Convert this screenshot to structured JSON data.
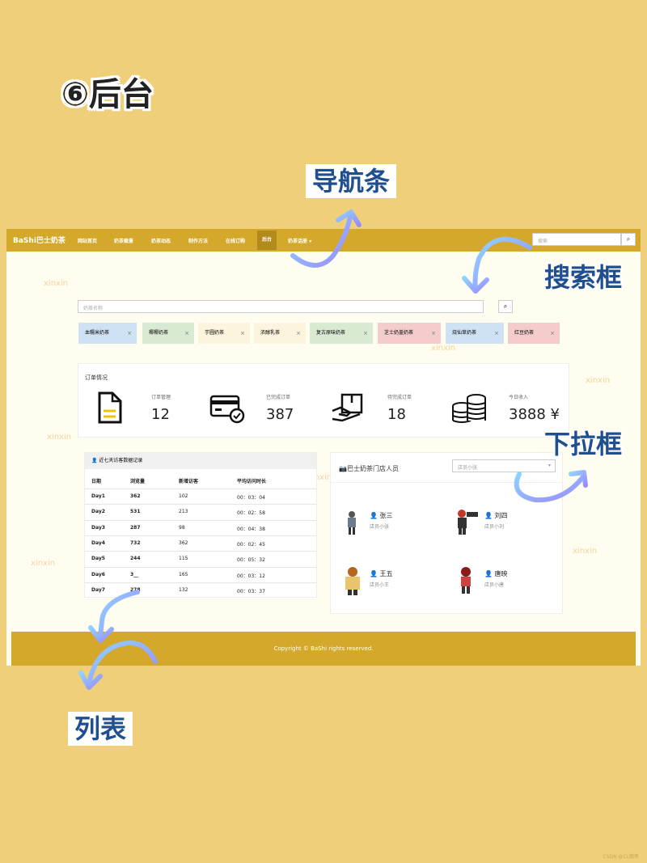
{
  "heading": "⑥后台",
  "callouts": {
    "navbar": "导航条",
    "search": "搜索框",
    "dropdown": "下拉框",
    "list": "列表"
  },
  "nav": {
    "brand": "BaShi巴士奶茶",
    "items": [
      "网站首页",
      "奶茶截景",
      "奶茶动态",
      "制作方法",
      "在线订购",
      "后台",
      "奶茶话册 ▾"
    ],
    "active_index": 5,
    "search_placeholder": "搜索"
  },
  "search": {
    "placeholder": "奶茶名称",
    "button_icon": "search-icon"
  },
  "tags": [
    {
      "label": "血糯米奶茶",
      "bg": "#cfe2f3"
    },
    {
      "label": "椰椰奶茶",
      "bg": "#d9ead3"
    },
    {
      "label": "芋圆奶茶",
      "bg": "#fcf4dc"
    },
    {
      "label": "浓醇乳茶",
      "bg": "#fcf4dc"
    },
    {
      "label": "复古原味奶茶",
      "bg": "#d9ead3"
    },
    {
      "label": "芝士奶盖奶茶",
      "bg": "#f4cccc"
    },
    {
      "label": "烧仙草奶茶",
      "bg": "#cfe2f3"
    },
    {
      "label": "红豆奶茶",
      "bg": "#f4cccc"
    }
  ],
  "watermark_text": "xinxin",
  "orders": {
    "title": "订单情况",
    "stats": [
      {
        "label": "订单管理",
        "value": "12",
        "icon": "document-icon"
      },
      {
        "label": "已完成订单",
        "value": "387",
        "icon": "credit-card-icon"
      },
      {
        "label": "待完成订单",
        "value": "18",
        "icon": "delivery-box-icon"
      },
      {
        "label": "今日收入",
        "value": "3888 ¥",
        "icon": "coins-icon"
      }
    ]
  },
  "visits": {
    "title": "近七天访客数据记录",
    "columns": [
      "日期",
      "浏览量",
      "新增访客",
      "平均访问时长"
    ],
    "rows": [
      [
        "Day1",
        "362",
        "102",
        "00：03：04"
      ],
      [
        "Day2",
        "531",
        "213",
        "00：02：58"
      ],
      [
        "Day3",
        "287",
        "98",
        "00：04：38"
      ],
      [
        "Day4",
        "732",
        "362",
        "00：02：45"
      ],
      [
        "Day5",
        "244",
        "115",
        "00：05：32"
      ],
      [
        "Day6",
        "3__",
        "165",
        "00：03：12"
      ],
      [
        "Day7",
        "278",
        "132",
        "00：03：37"
      ]
    ]
  },
  "staff": {
    "title": "巴士奶茶门店人员",
    "select_value": "店员小张",
    "members": [
      {
        "name": "张三",
        "store": "店员小张"
      },
      {
        "name": "刘四",
        "store": "店员小刘"
      },
      {
        "name": "王五",
        "store": "店员小王"
      },
      {
        "name": "唐映",
        "store": "店员小唐"
      }
    ]
  },
  "footer": "Copyright © BaShi rights reserved.",
  "corner_mark": "CSDN @CL蜡笔"
}
